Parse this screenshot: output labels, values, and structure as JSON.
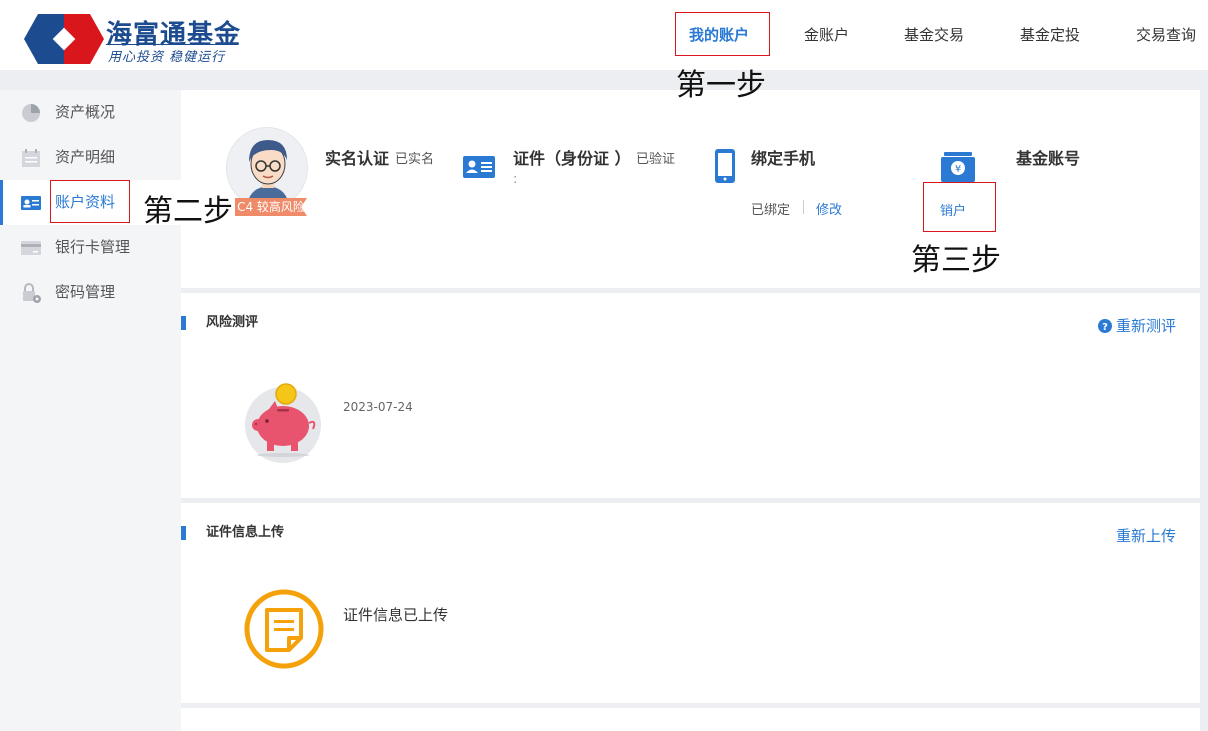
{
  "header": {
    "logo_title": "海富通基金",
    "logo_sub": "用心投资 稳健运行",
    "nav": [
      {
        "label": "我的账户",
        "active": true
      },
      {
        "label": "金账户"
      },
      {
        "label": "基金交易"
      },
      {
        "label": "基金定投"
      },
      {
        "label": "交易查询"
      }
    ]
  },
  "annotations": {
    "step1": "第一步",
    "step2": "第二步",
    "step3": "第三步"
  },
  "sidebar": {
    "items": [
      {
        "label": "资产概况",
        "icon": "pie-chart-icon"
      },
      {
        "label": "资产明细",
        "icon": "calendar-list-icon"
      },
      {
        "label": "账户资料",
        "icon": "id-card-icon",
        "active": true
      },
      {
        "label": "银行卡管理",
        "icon": "bank-card-icon"
      },
      {
        "label": "密码管理",
        "icon": "lock-gear-icon"
      }
    ]
  },
  "account": {
    "risk_tag": "C4 较高风险",
    "realname": {
      "title": "实名认证",
      "status": "已实名"
    },
    "idcard": {
      "title": "证件（身份证 ）",
      "status": "已验证",
      "note": ":"
    },
    "phone": {
      "title": "绑定手机",
      "status": "已绑定",
      "modify": "修改"
    },
    "fund_account": {
      "title": "基金账号",
      "action": "销户"
    }
  },
  "risk_section": {
    "title": "风险测评",
    "link": "重新测评",
    "date": "2023-07-24"
  },
  "upload_section": {
    "title": "证件信息上传",
    "link": "重新上传",
    "status": "证件信息已上传"
  },
  "colors": {
    "accent": "#2a7ad3",
    "annotation_red": "#d9161c",
    "brand": "#1c4b8f",
    "orange": "#f5a20a"
  }
}
